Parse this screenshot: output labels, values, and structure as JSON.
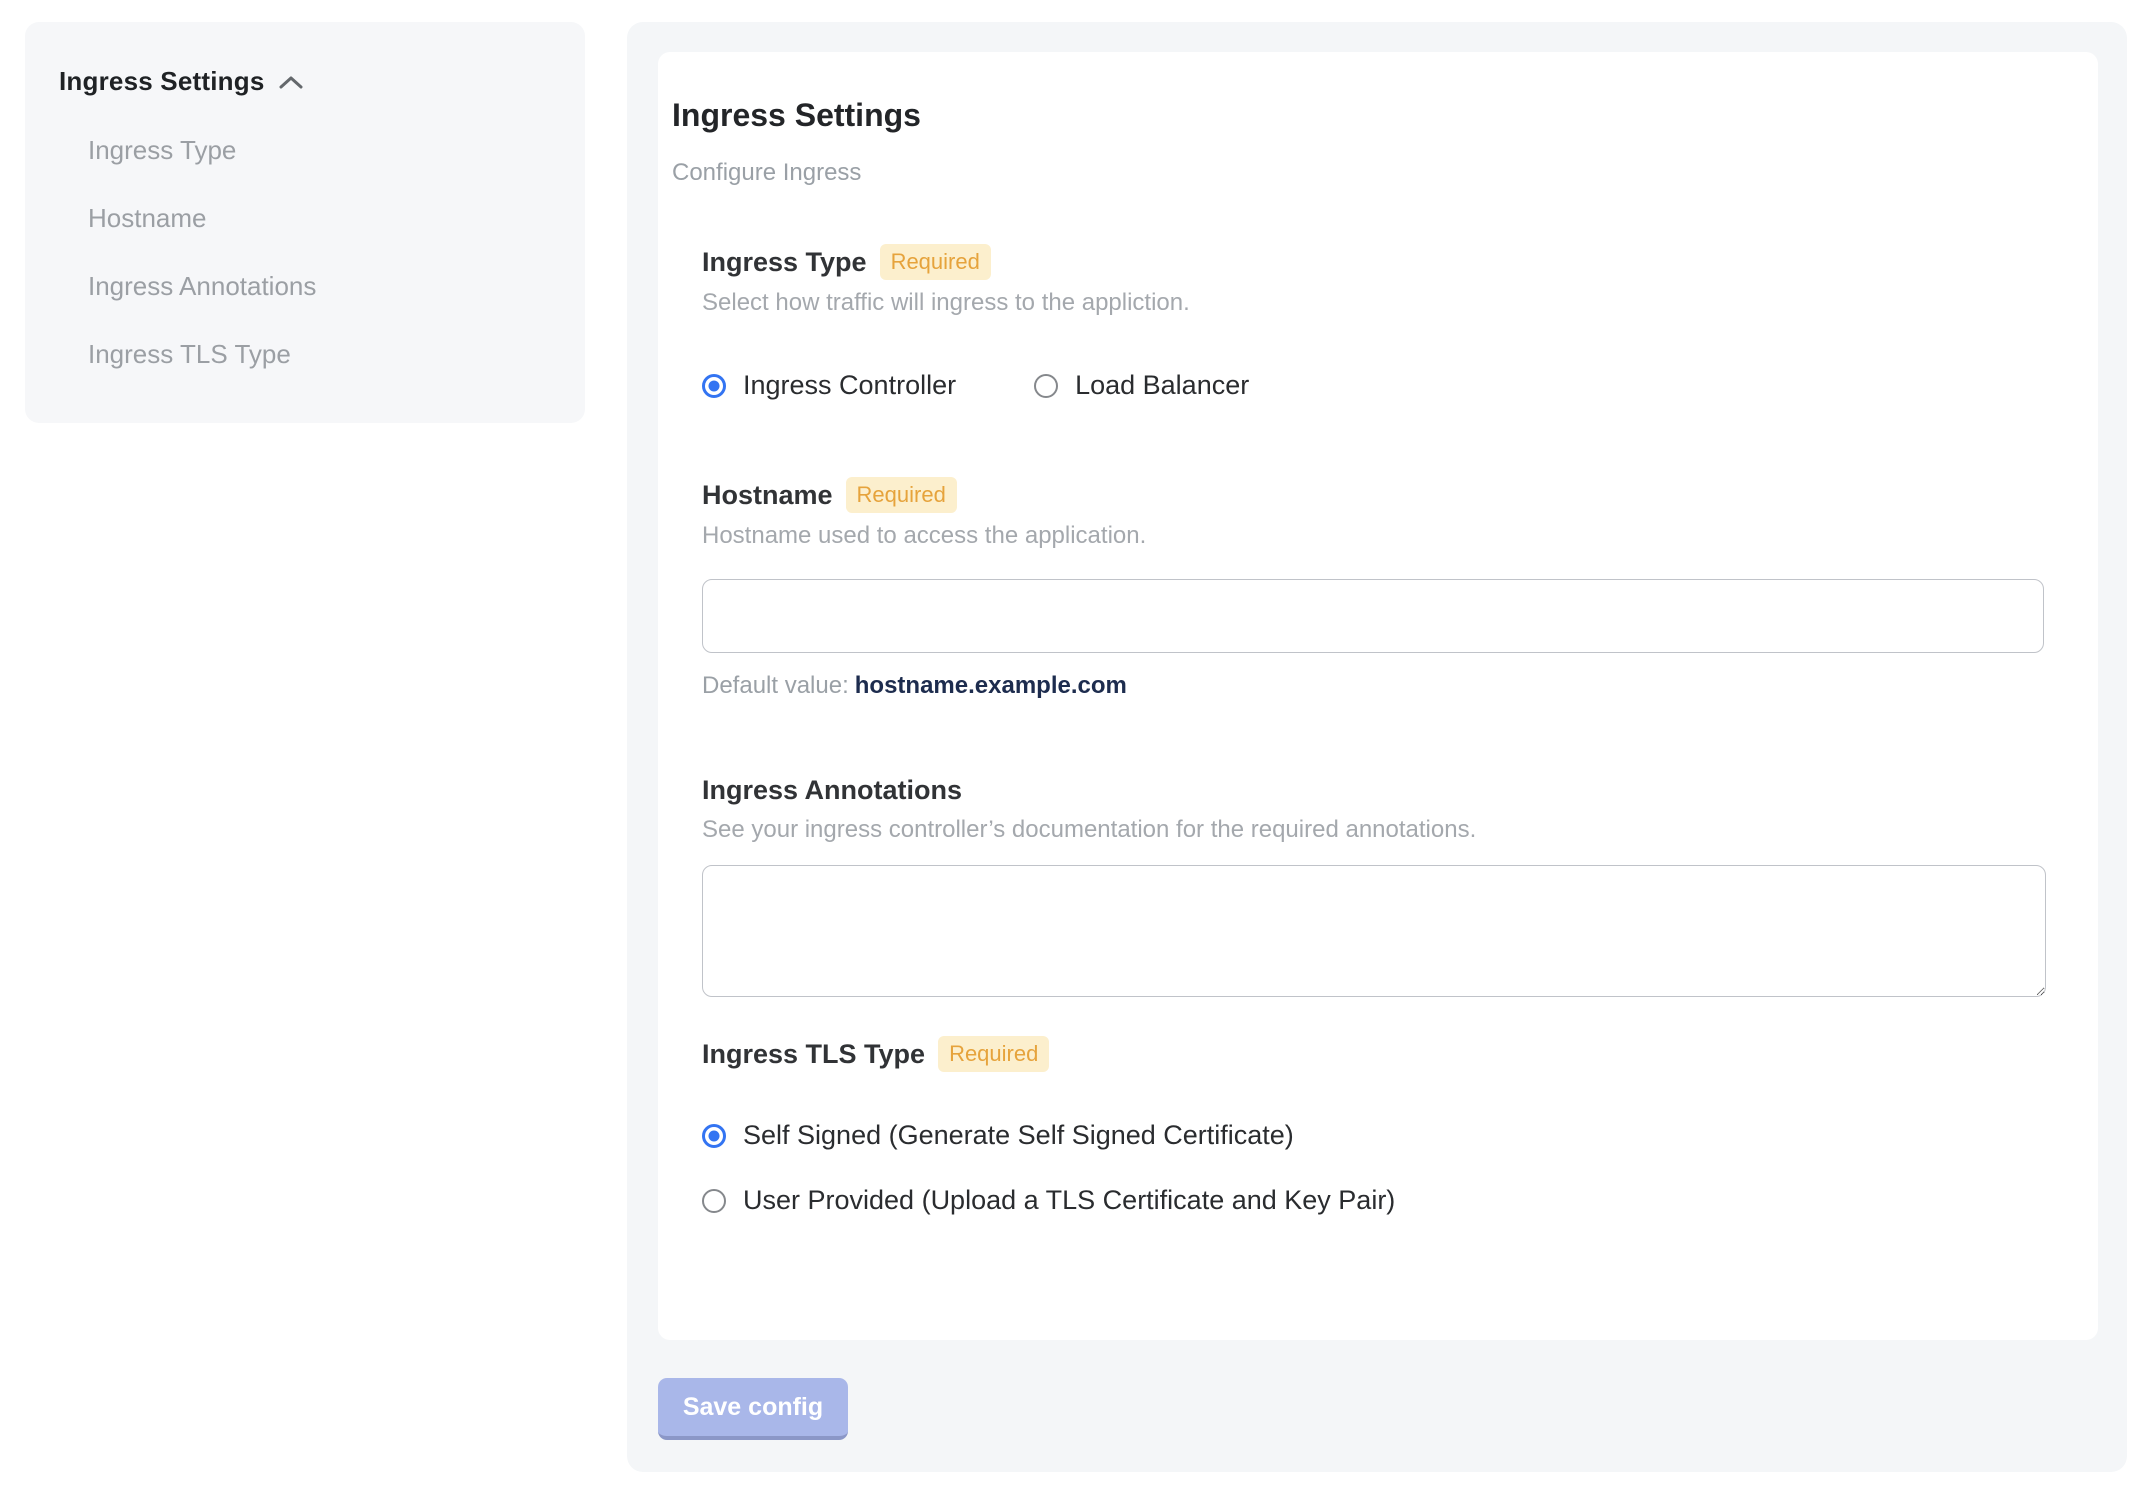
{
  "sidebar": {
    "title": "Ingress Settings",
    "items": [
      {
        "label": "Ingress Type"
      },
      {
        "label": "Hostname"
      },
      {
        "label": "Ingress Annotations"
      },
      {
        "label": "Ingress TLS Type"
      }
    ]
  },
  "main": {
    "title": "Ingress Settings",
    "subtitle": "Configure Ingress",
    "sections": {
      "ingress_type": {
        "title": "Ingress Type",
        "required_badge": "Required",
        "description": "Select how traffic will ingress to the appliction.",
        "options": [
          {
            "label": "Ingress Controller",
            "selected": true
          },
          {
            "label": "Load Balancer",
            "selected": false
          }
        ]
      },
      "hostname": {
        "title": "Hostname",
        "required_badge": "Required",
        "description": "Hostname used to access the application.",
        "input_value": "",
        "default_label": "Default value:",
        "default_value": "hostname.example.com"
      },
      "annotations": {
        "title": "Ingress Annotations",
        "description": "See your ingress controller’s documentation for the required annotations.",
        "textarea_value": ""
      },
      "tls": {
        "title": "Ingress TLS Type",
        "required_badge": "Required",
        "options": [
          {
            "label": "Self Signed (Generate Self Signed Certificate)",
            "selected": true
          },
          {
            "label": "User Provided (Upload a TLS Certificate and Key Pair)",
            "selected": false
          }
        ]
      }
    },
    "save_button_label": "Save config"
  },
  "colors": {
    "accent_blue": "#3374f2",
    "badge_bg": "#fcefcd",
    "badge_text": "#e6a33c",
    "panel_bg": "#f4f6f8",
    "sidebar_bg": "#f6f7f9",
    "save_button_bg": "#a9b7e9",
    "default_value_text": "#1d2c4e"
  }
}
